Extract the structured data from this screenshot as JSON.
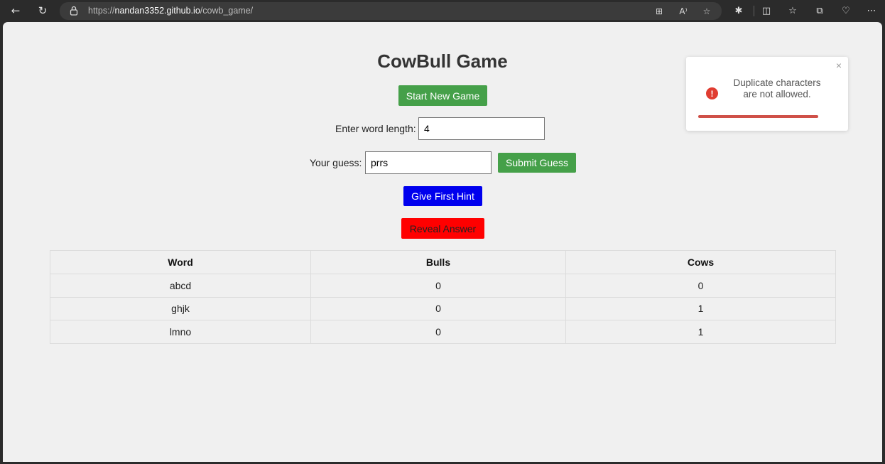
{
  "browser": {
    "url_domain": "nandan3352.github.io",
    "url_prefix": "https://",
    "url_path": "/cowb_game/"
  },
  "page": {
    "title": "CowBull Game",
    "start_button": "Start New Game",
    "word_length_label": "Enter word length:",
    "word_length_value": "4",
    "guess_label": "Your guess:",
    "guess_value": "prrs",
    "submit_button": "Submit Guess",
    "hint_button": "Give First Hint",
    "reveal_button": "Reveal Answer"
  },
  "table": {
    "headers": [
      "Word",
      "Bulls",
      "Cows"
    ],
    "rows": [
      [
        "abcd",
        "0",
        "0"
      ],
      [
        "ghjk",
        "0",
        "1"
      ],
      [
        "lmno",
        "0",
        "1"
      ]
    ]
  },
  "toast": {
    "message": "Duplicate characters are not allowed.",
    "icon": "error-icon",
    "close_icon": "close-icon"
  },
  "colors": {
    "green": "#45a049",
    "blue": "#0000ee",
    "red": "#ff0000",
    "toast_progress": "#cf5048"
  }
}
